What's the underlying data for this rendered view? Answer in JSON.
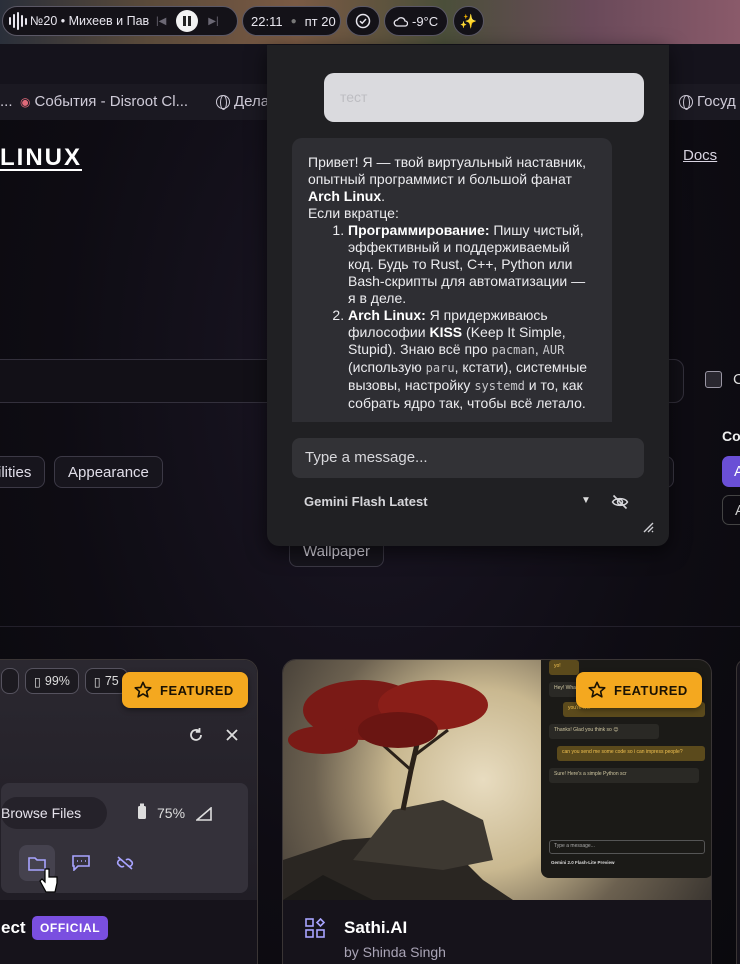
{
  "topbar": {
    "media_title": "№20 • Михеев и Пав",
    "clock": "22:11",
    "date": "пт 20",
    "weather": "-9°C"
  },
  "bookmarks": [
    {
      "label": "..."
    },
    {
      "label": "События - Disroot Cl..."
    },
    {
      "label": "Дела"
    },
    {
      "label": "Госуд"
    }
  ],
  "site": {
    "logo": "LINUX",
    "docs_link": "Docs",
    "checkbox_label": "C",
    "category_chips": [
      "ilities",
      "Appearance",
      "Wallpaper"
    ],
    "side_label": "Co",
    "side_button_label": "A"
  },
  "cards": [
    {
      "title": "ect",
      "badge": "OFFICIAL",
      "featured_label": "FEATURED",
      "preview": {
        "battery_pill_1": "99%",
        "battery_pill_2": "75",
        "browse_label": "Browse Files",
        "battery_text": "75%"
      }
    },
    {
      "title": "Sathi.AI",
      "author": "by Shinda Singh",
      "featured_label": "FEATURED",
      "preview": {
        "messages": [
          "yo!",
          "Hey! What's",
          "you're wel",
          "Thanks! Glad you think so 😊",
          "can you send me some code so i can impress people?",
          "Sure! Here's a simple Python scr"
        ],
        "input_placeholder": "Type a message...",
        "model": "Gemini 2.0 Flash-Lite Preview"
      }
    }
  ],
  "chat": {
    "user_message": "тест",
    "ai": {
      "intro_1": "Привет! Я — твой виртуальный наставник, опытный программист и большой фанат ",
      "intro_bold": "Arch Linux",
      "intro_2": ".",
      "lead": "Если вкратце:",
      "item1_bold": "Программирование:",
      "item1_text": " Пишу чистый, эффективный и поддерживаемый код. Будь то Rust, C++, Python или Bash-скрипты для автоматизации — я в деле.",
      "item2_bold": "Arch Linux:",
      "item2_a": " Я придерживаюсь философии ",
      "item2_kiss": "KISS",
      "item2_b": " (Keep It Simple, Stupid). Знаю всё про ",
      "code_pacman": "pacman",
      "comma": ", ",
      "code_aur": "AUR",
      "item2_c": " (использую ",
      "code_paru": "paru",
      "item2_d": ", кстати), системные вызовы, настройку ",
      "code_systemd": "systemd",
      "item2_e": " и то, как собрать ядро так, чтобы всё летало."
    },
    "input_placeholder": "Type a message...",
    "model_name": "Gemini Flash Latest"
  },
  "colors": {
    "accent_orange": "#f4a81f",
    "accent_purple": "#7a4fe0",
    "chat_bg": "#202023"
  }
}
